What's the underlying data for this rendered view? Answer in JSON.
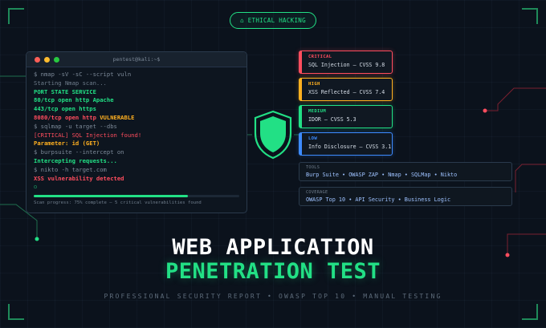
{
  "badge": {
    "label": "⌂ ETHICAL HACKING"
  },
  "terminal": {
    "title": "pentest@kali:~$",
    "lines": [
      {
        "text": "$ nmap -sV -sC --script vuln",
        "style": "cmd"
      },
      {
        "text": "Starting Nmap scan...",
        "style": "dim"
      },
      {
        "text": "PORT STATE SERVICE",
        "style": "ok"
      },
      {
        "text": "80/tcp open http Apache",
        "style": "ok"
      },
      {
        "text": "443/tcp open https",
        "style": "ok"
      },
      {
        "text": "$ sqlmap -u target --dbs",
        "style": "cmd"
      },
      {
        "text": "[CRITICAL] SQL Injection found!",
        "style": "crit"
      },
      {
        "text": "Parameter: id (GET)",
        "style": "warn"
      },
      {
        "text": "$ burpsuite --intercept on",
        "style": "cmd"
      },
      {
        "text": "Intercepting requests...",
        "style": "ok"
      },
      {
        "text": "$ nikto -h target.com",
        "style": "cmd"
      },
      {
        "text": "XSS vulnerability detected",
        "style": "crit"
      }
    ],
    "vuln_line": {
      "port": "8080/tcp open http",
      "status": "VULNERABLE"
    },
    "cursor": "▫",
    "progress": {
      "fraction": 0.75,
      "text": "Scan progress: 75% complete — 5 critical vulnerabilities found"
    }
  },
  "vulns": {
    "critical": {
      "severity": "CRITICAL",
      "name": "SQL Injection — CVSS 9.8"
    },
    "high": {
      "severity": "HIGH",
      "name": "XSS Reflected — CVSS 7.4"
    },
    "medium": {
      "severity": "MEDIUM",
      "name": "IDOR — CVSS 5.3"
    },
    "low": {
      "severity": "LOW",
      "name": "Info Disclosure — CVSS 3.1"
    }
  },
  "tools": {
    "label": "TOOLS",
    "value": "Burp Suite • OWASP ZAP • Nmap • SQLMap • Nikto"
  },
  "coverage": {
    "label": "COVERAGE",
    "value": "OWASP Top 10 • API Security • Business Logic"
  },
  "title": {
    "line1": "WEB APPLICATION",
    "line2": "PENETRATION TEST",
    "subtitle": "PROFESSIONAL SECURITY REPORT • OWASP TOP 10 • MANUAL TESTING"
  },
  "colors": {
    "accent": "#22e085",
    "critical": "#ff4d5e",
    "high": "#ffb020",
    "low": "#3d8bff",
    "background": "#0b121c"
  },
  "icons": {
    "shield": "shield-icon"
  }
}
